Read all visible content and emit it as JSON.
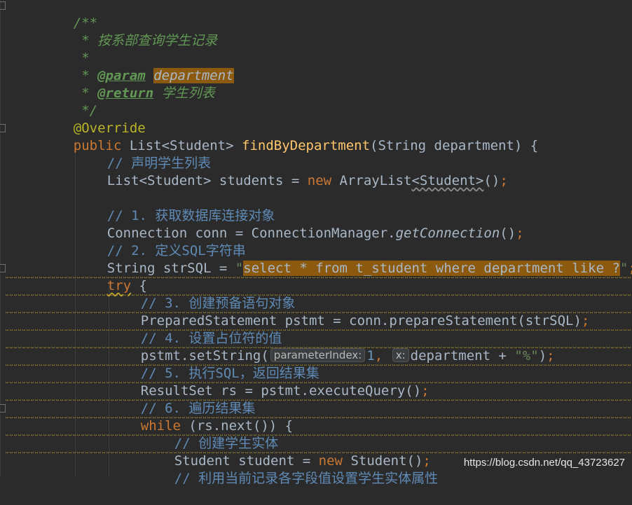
{
  "lines": {
    "l0": "/**",
    "l1": " * 按系部查询学生记录",
    "l2": " *",
    "l3_star": " * ",
    "l3_tag": "@param",
    "l3_arg": "department",
    "l4_star": " * ",
    "l4_tag": "@return",
    "l4_desc": " 学生列表",
    "l5": " */",
    "l6": "@Override",
    "l7_kw": "public",
    "l7_a": " List<Student> ",
    "l7_method": "findByDepartment",
    "l7_b": "(String department) {",
    "l8": "// 声明学生列表",
    "l9_a": "List<Student> students = ",
    "l9_kw": "new",
    "l9_b": " ArrayList",
    "l9_c": "<Student>",
    "l9_d": "()",
    "l9_e": ";",
    "l11": "// 1. 获取数据库连接对象",
    "l12_a": "Connection conn = ConnectionManager.",
    "l12_m": "getConnection",
    "l12_b": "()",
    "l12_c": ";",
    "l13": "// 2. 定义SQL字符串",
    "l14_a": "String strSQL = ",
    "l14_q1": "\"",
    "l14_sql": "select * from t_student where department like ?",
    "l14_q2": "\"",
    "l14_b": ";",
    "l15_kw": "try",
    "l15_b": " {",
    "l16": "// 3. 创建预备语句对象",
    "l17_a": "PreparedStatement pstmt = conn.prepareStatement(strSQL)",
    "l17_b": ";",
    "l18": "// 4. 设置占位符的值",
    "l19_a": "pstmt.setString(",
    "l19_hint1": "parameterIndex:",
    "l19_num": "1",
    "l19_comma": ",",
    "l19_hint2": "x:",
    "l19_b": "department + ",
    "l19_str": "\"%\"",
    "l19_c": ")",
    "l19_d": ";",
    "l20": "// 5. 执行SQL，返回结果集",
    "l21_a": "ResultSet rs = pstmt.executeQuery()",
    "l21_b": ";",
    "l22": "// 6. 遍历结果集",
    "l23_kw": "while",
    "l23_b": " (rs.next()) {",
    "l24": "// 创建学生实体",
    "l25_a": "Student student = ",
    "l25_kw": "new",
    "l25_b": " Student()",
    "l25_c": ";",
    "l26": "// 利用当前记录各字段值设置学生实体属性"
  },
  "watermark": "https://blog.csdn.net/qq_43723627",
  "colors": {
    "background": "#2b2b2b",
    "keyword": "#cc7832",
    "doc_comment": "#629755",
    "string": "#6a8759",
    "method": "#ffc66d",
    "number": "#6897bb",
    "highlight": "#8b5a0f"
  }
}
